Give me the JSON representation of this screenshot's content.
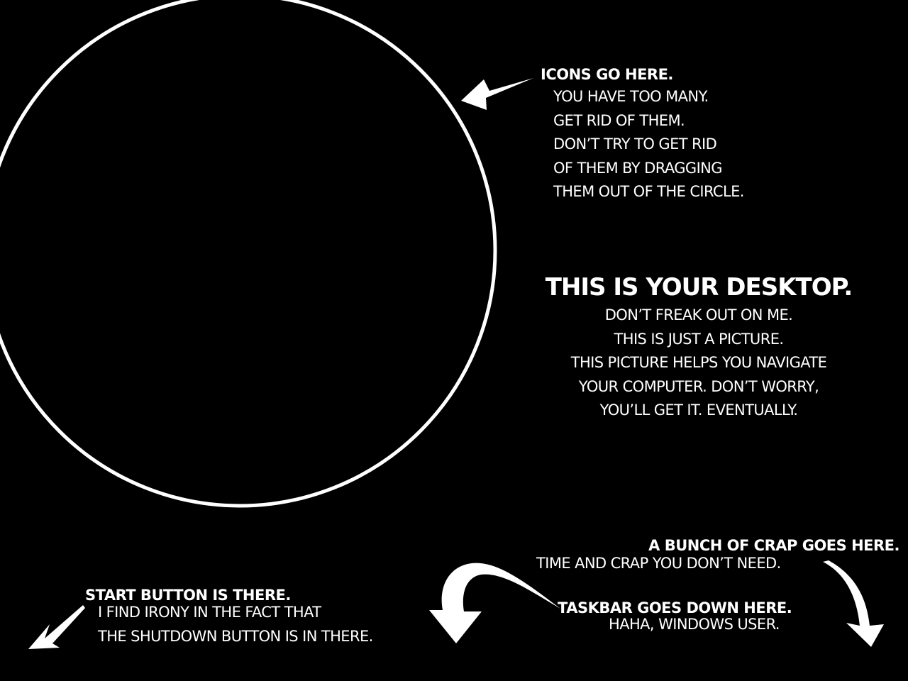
{
  "colors": {
    "background": "#000000",
    "foreground": "#ffffff"
  },
  "icons_note": {
    "heading": "ICONS GO HERE.",
    "lines": [
      "YOU HAVE TOO MANY.",
      "GET RID OF THEM.",
      "DON’T TRY TO GET RID",
      "OF THEM BY DRAGGING",
      "THEM OUT OF THE CIRCLE."
    ]
  },
  "desktop_note": {
    "heading": "THIS IS YOUR DESKTOP.",
    "lines": [
      "DON’T FREAK OUT ON ME.",
      "THIS IS JUST A PICTURE.",
      "THIS PICTURE HELPS YOU NAVIGATE",
      "YOUR COMPUTER. DON’T WORRY,",
      "YOU’LL GET IT. EVENTUALLY."
    ]
  },
  "crap_note": {
    "heading": "A BUNCH OF CRAP GOES HERE.",
    "line": "TIME AND CRAP YOU DON’T NEED."
  },
  "taskbar_note": {
    "heading": "TASKBAR GOES DOWN HERE.",
    "line": "HAHA, WINDOWS USER."
  },
  "start_note": {
    "heading": "START BUTTON IS THERE.",
    "lines": [
      "I FIND IRONY IN THE FACT THAT",
      "THE SHUTDOWN BUTTON IS IN THERE."
    ]
  },
  "icons": {
    "circle": "icon-area-circle",
    "arrows": [
      "arrow-icon"
    ]
  }
}
